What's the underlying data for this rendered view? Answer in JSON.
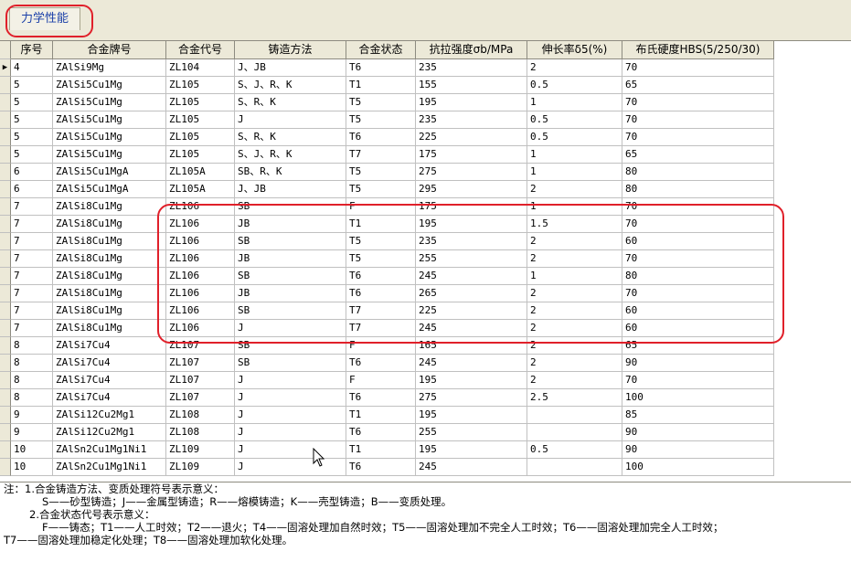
{
  "tab": {
    "label": "力学性能"
  },
  "table": {
    "headers": [
      "序号",
      "合金牌号",
      "合金代号",
      "铸造方法",
      "合金状态",
      "抗拉强度σb/MPa",
      "伸长率δ5(%)",
      "布氏硬度HBS(5/250/30)"
    ],
    "rows": [
      [
        "4",
        "ZAlSi9Mg",
        "ZL104",
        "J、JB",
        "T6",
        "235",
        "2",
        "70"
      ],
      [
        "5",
        "ZAlSi5Cu1Mg",
        "ZL105",
        "S、J、R、K",
        "T1",
        "155",
        "0.5",
        "65"
      ],
      [
        "5",
        "ZAlSi5Cu1Mg",
        "ZL105",
        "S、R、K",
        "T5",
        "195",
        "1",
        "70"
      ],
      [
        "5",
        "ZAlSi5Cu1Mg",
        "ZL105",
        "J",
        "T5",
        "235",
        "0.5",
        "70"
      ],
      [
        "5",
        "ZAlSi5Cu1Mg",
        "ZL105",
        "S、R、K",
        "T6",
        "225",
        "0.5",
        "70"
      ],
      [
        "5",
        "ZAlSi5Cu1Mg",
        "ZL105",
        "S、J、R、K",
        "T7",
        "175",
        "1",
        "65"
      ],
      [
        "6",
        "ZAlSi5Cu1MgA",
        "ZL105A",
        "SB、R、K",
        "T5",
        "275",
        "1",
        "80"
      ],
      [
        "6",
        "ZAlSi5Cu1MgA",
        "ZL105A",
        "J、JB",
        "T5",
        "295",
        "2",
        "80"
      ],
      [
        "7",
        "ZAlSi8Cu1Mg",
        "ZL106",
        "SB",
        "F",
        "175",
        "1",
        "70"
      ],
      [
        "7",
        "ZAlSi8Cu1Mg",
        "ZL106",
        "JB",
        "T1",
        "195",
        "1.5",
        "70"
      ],
      [
        "7",
        "ZAlSi8Cu1Mg",
        "ZL106",
        "SB",
        "T5",
        "235",
        "2",
        "60"
      ],
      [
        "7",
        "ZAlSi8Cu1Mg",
        "ZL106",
        "JB",
        "T5",
        "255",
        "2",
        "70"
      ],
      [
        "7",
        "ZAlSi8Cu1Mg",
        "ZL106",
        "SB",
        "T6",
        "245",
        "1",
        "80"
      ],
      [
        "7",
        "ZAlSi8Cu1Mg",
        "ZL106",
        "JB",
        "T6",
        "265",
        "2",
        "70"
      ],
      [
        "7",
        "ZAlSi8Cu1Mg",
        "ZL106",
        "SB",
        "T7",
        "225",
        "2",
        "60"
      ],
      [
        "7",
        "ZAlSi8Cu1Mg",
        "ZL106",
        "J",
        "T7",
        "245",
        "2",
        "60"
      ],
      [
        "8",
        "ZAlSi7Cu4",
        "ZL107",
        "SB",
        "F",
        "165",
        "2",
        "65"
      ],
      [
        "8",
        "ZAlSi7Cu4",
        "ZL107",
        "SB",
        "T6",
        "245",
        "2",
        "90"
      ],
      [
        "8",
        "ZAlSi7Cu4",
        "ZL107",
        "J",
        "F",
        "195",
        "2",
        "70"
      ],
      [
        "8",
        "ZAlSi7Cu4",
        "ZL107",
        "J",
        "T6",
        "275",
        "2.5",
        "100"
      ],
      [
        "9",
        "ZAlSi12Cu2Mg1",
        "ZL108",
        "J",
        "T1",
        "195",
        "",
        "85"
      ],
      [
        "9",
        "ZAlSi12Cu2Mg1",
        "ZL108",
        "J",
        "T6",
        "255",
        "",
        "90"
      ],
      [
        "10",
        "ZAlSn2Cu1Mg1Ni1",
        "ZL109",
        "J",
        "T1",
        "195",
        "0.5",
        "90"
      ],
      [
        "10",
        "ZAlSn2Cu1Mg1Ni1",
        "ZL109",
        "J",
        "T6",
        "245",
        "",
        "100"
      ]
    ]
  },
  "notes": {
    "line1": "注：1.合金铸造方法、变质处理符号表示意义：",
    "line2": "S——砂型铸造；J——金属型铸造；R——熔模铸造；K——壳型铸造；B——变质处理。",
    "line3": "2.合金状态代号表示意义：",
    "line4": "F——铸态；T1——人工时效；T2——退火；T4——固溶处理加自然时效；T5——固溶处理加不完全人工时效；T6——固溶处理加完全人工时效；",
    "line5": "T7——固溶处理加稳定化处理；T8——固溶处理加软化处理。"
  },
  "colors": {
    "highlight": "#e0202a",
    "tab_text": "#1a3fa8"
  }
}
